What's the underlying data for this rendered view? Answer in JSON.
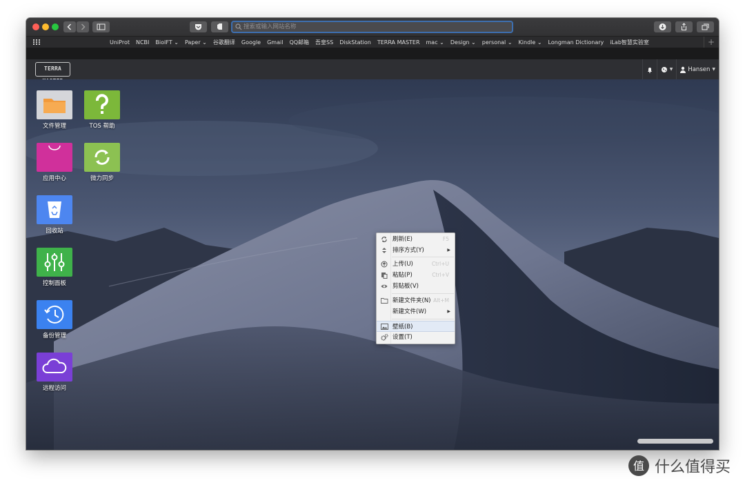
{
  "browser": {
    "url_placeholder": "搜索或输入网站名称",
    "bookmarks": [
      "UniProt",
      "NCBI",
      "BioIFT ⌄",
      "Paper ⌄",
      "谷歌翻译",
      "Google",
      "Gmail",
      "QQ邮箱",
      "吾皇SS",
      "DiskStation",
      "TERRA MASTER",
      "mac ⌄",
      "Design ⌄",
      "personal ⌄",
      "Kindle ⌄",
      "Longman Dictionary",
      "iLab智慧实验室"
    ]
  },
  "nas": {
    "logo": "TERRA MASTER",
    "user": "Hansen"
  },
  "desktop_icons": [
    {
      "label": "文件管理",
      "icon": "folder-icon",
      "color": "#f29a3c"
    },
    {
      "label": "TOS 帮助",
      "icon": "question-icon",
      "color": "#7cb83a"
    },
    {
      "label": "应用中心",
      "icon": "shopping-bag-icon",
      "color": "#d0309b"
    },
    {
      "label": "微力同步",
      "icon": "sync-icon",
      "color": "#8cc152"
    },
    {
      "label": "回收站",
      "icon": "recycle-bin-icon",
      "color": "#4d86f0"
    },
    {
      "label": "控制面板",
      "icon": "sliders-icon",
      "color": "#3fb24a"
    },
    {
      "label": "备份管理",
      "icon": "clock-icon",
      "color": "#3b82f0"
    },
    {
      "label": "远程访问",
      "icon": "cloud-icon",
      "color": "#7a3fd6"
    }
  ],
  "context_menu": {
    "items": [
      {
        "label": "刷新(E)",
        "shortcut": "F5",
        "icon": "refresh-icon"
      },
      {
        "label": "排序方式(Y)",
        "submenu": "▶",
        "icon": "sort-icon"
      },
      {
        "label": "上传(U)",
        "shortcut": "Ctrl+U",
        "icon": "upload-icon"
      },
      {
        "label": "粘贴(P)",
        "shortcut": "Ctrl+V",
        "icon": "paste-icon"
      },
      {
        "label": "剪贴板(V)",
        "icon": "eye-icon"
      },
      {
        "label": "新建文件夹(N)",
        "shortcut": "Alt+M",
        "icon": "folder-outline-icon"
      },
      {
        "label": "新建文件(W)",
        "submenu": "▶"
      },
      {
        "label": "壁纸(B)",
        "icon": "image-icon"
      },
      {
        "label": "设置(T)",
        "icon": "gears-icon"
      }
    ]
  },
  "watermark": {
    "logo_char": "值",
    "text": "什么值得买"
  },
  "colors": {
    "url_focus": "#3d6fb0",
    "menu_highlight": "#e2eaf6"
  }
}
